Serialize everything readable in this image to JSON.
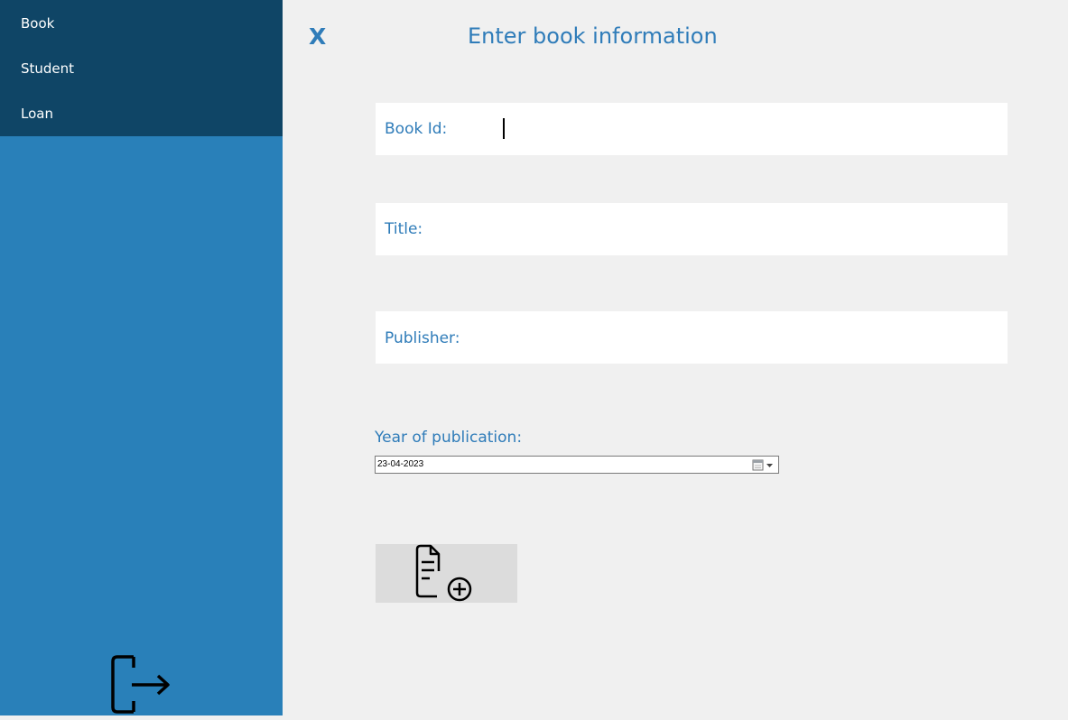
{
  "sidebar": {
    "items": [
      {
        "label": "Book"
      },
      {
        "label": "Student"
      },
      {
        "label": "Loan"
      }
    ]
  },
  "header": {
    "close_label": "X",
    "title": "Enter book information"
  },
  "form": {
    "book_id": {
      "label": "Book Id:",
      "value": ""
    },
    "title": {
      "label": "Title:",
      "value": ""
    },
    "publisher": {
      "label": "Publisher:",
      "value": ""
    },
    "year": {
      "label": "Year of publication:",
      "value": "23-04-2023"
    }
  },
  "icons": {
    "logout": "logout-icon",
    "add": "add-document-icon",
    "calendar": "calendar-icon"
  },
  "colors": {
    "nav_bg": "#0f4566",
    "sidebar_bg": "#2980b9",
    "accent_text": "#2f7cb9",
    "main_bg": "#f0f0f0"
  }
}
